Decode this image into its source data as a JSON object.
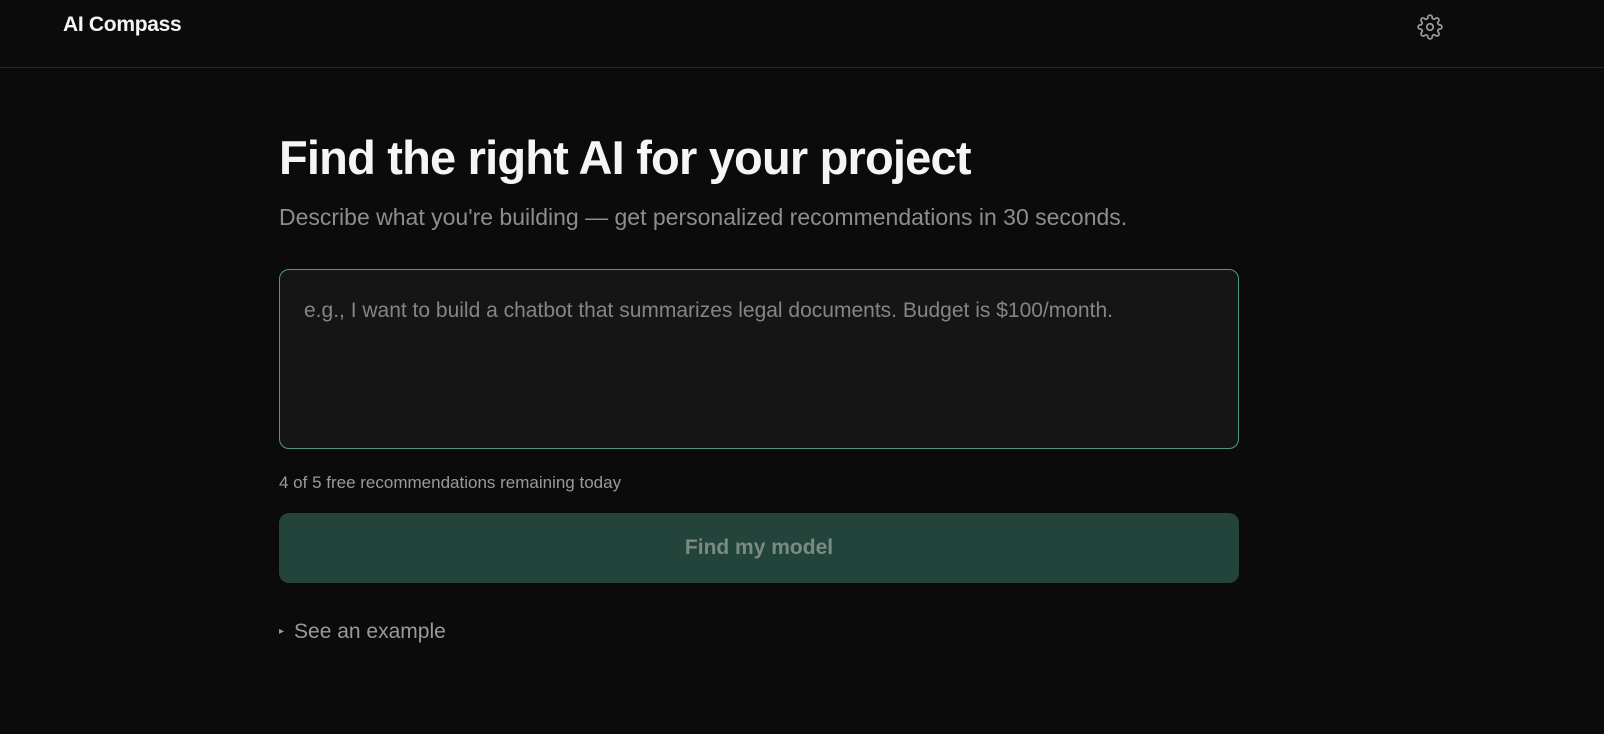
{
  "header": {
    "brand": "AI Compass",
    "settings_icon": "gear-icon"
  },
  "hero": {
    "title": "Find the right AI for your project",
    "subtitle": "Describe what you're building — get personalized recommendations in 30 seconds."
  },
  "prompt": {
    "placeholder": "e.g., I want to build a chatbot that summarizes legal documents. Budget is $100/month.",
    "value": ""
  },
  "quota": {
    "text": "4 of 5 free recommendations remaining today"
  },
  "cta": {
    "label": "Find my model"
  },
  "example": {
    "toggle_icon": "triangle-right-icon",
    "label": "See an example"
  },
  "colors": {
    "background": "#0b0b0b",
    "accent_border": "#4b9a7f",
    "button_bg": "#23443a",
    "button_text": "#7a8b85"
  }
}
